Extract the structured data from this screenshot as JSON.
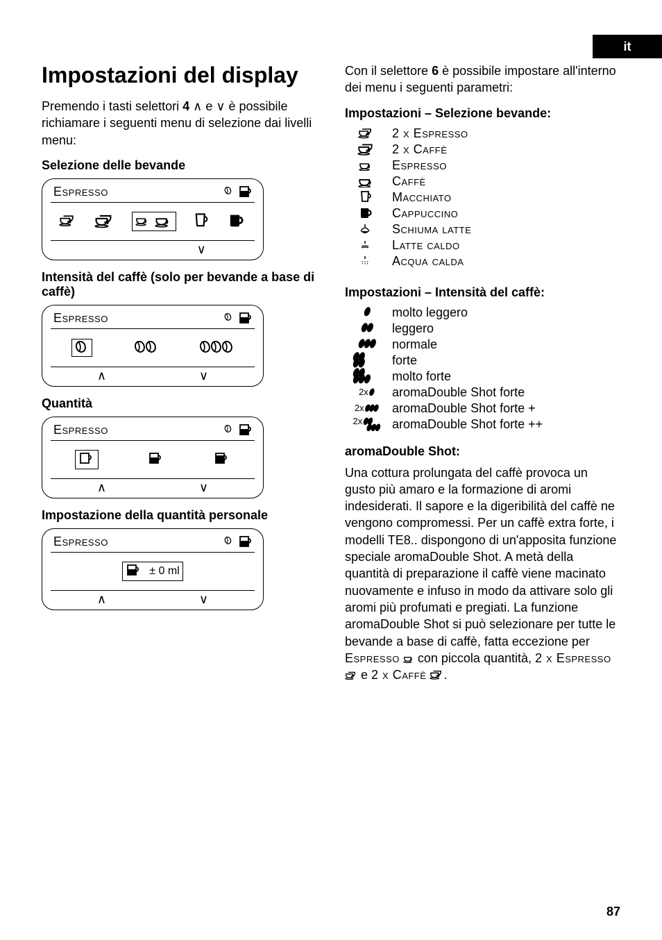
{
  "lang_tab": "it",
  "left": {
    "title": "Impostazioni del display",
    "intro_pre": "Premendo i tasti selettori ",
    "intro_bold1": "4",
    "intro_mid": " e ",
    "intro_post": " è possibile richiamare i seguenti menu di selezione dai livelli menu:",
    "sec1": "Selezione delle bevande",
    "sec2": "Intensità del caffè (solo per bevande a base di caffè)",
    "sec3": "Quantità",
    "sec4": "Impostazione della quantità personale",
    "display_title": "Espresso",
    "qty_adjust": "± 0 ml"
  },
  "right": {
    "intro_pre": "Con il selettore ",
    "intro_bold": "6",
    "intro_post": " è possibile impostare all'interno dei menu i seguenti parametri:",
    "sec_bev": "Impostazioni – Selezione bevande:",
    "bev": [
      "2 x Espresso",
      "2 x Caffè",
      "Espresso",
      "Caffè",
      "Macchiato",
      "Cappuccino",
      "Schiuma latte",
      "Latte caldo",
      "Acqua calda"
    ],
    "sec_int": "Impostazioni – Intensità del caffè:",
    "intensity": [
      "molto leggero",
      "leggero",
      "normale",
      "forte",
      "molto forte",
      "aromaDouble Shot forte",
      "aromaDouble Shot forte +",
      "aromaDouble Shot forte ++"
    ],
    "aroma_title": "aromaDouble Shot:",
    "aroma_body_1": "Una cottura prolungata del caffè provoca un gusto più amaro e la formazione di aromi indesiderati. Il sapore e la digeribilità del caffè ne vengono compromessi. Per un caffè extra forte, i modelli TE8.. dispongono di un'apposita funzione speciale aromaDouble Shot. A metà della quantità di preparazione il caffè viene macinato nuovamente e infuso in modo da attivare solo gli aromi più profumati e pregiati. La funzione aromaDouble Shot si può selezionare per tutte le bevande a base di caffè, fatta eccezione per ",
    "aroma_esp": "Espresso",
    "aroma_mid": " con piccola quantità, ",
    "aroma_2esp": "2 x Espresso",
    "aroma_and": " e ",
    "aroma_2caf": "2 x Caffè",
    "aroma_end": "."
  },
  "page_number": "87"
}
